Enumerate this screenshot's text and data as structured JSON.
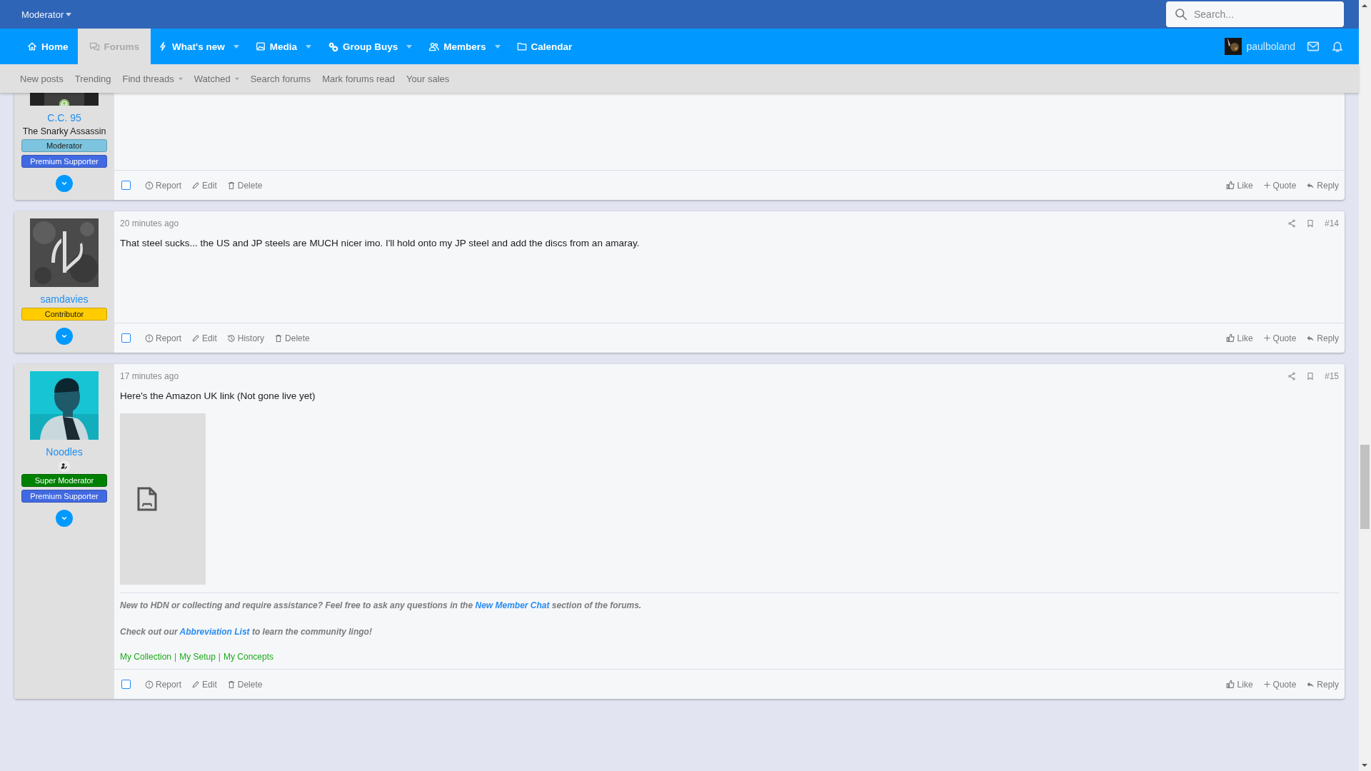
{
  "top_bar": {
    "menu_label": "Moderator",
    "search": {
      "placeholder": "Search..."
    }
  },
  "nav": {
    "tabs": [
      {
        "kind": "home",
        "label": "Home",
        "has_menu": false,
        "selected": false
      },
      {
        "kind": "forums",
        "label": "Forums",
        "has_menu": false,
        "selected": true
      },
      {
        "kind": "whats-new",
        "label": "What's new",
        "has_menu": true,
        "selected": false
      },
      {
        "kind": "media",
        "label": "Media",
        "has_menu": true,
        "selected": false
      },
      {
        "kind": "group-buys",
        "label": "Group Buys",
        "has_menu": true,
        "selected": false
      },
      {
        "kind": "members",
        "label": "Members",
        "has_menu": true,
        "selected": false
      },
      {
        "kind": "calendar",
        "label": "Calendar",
        "has_menu": false,
        "selected": false
      }
    ],
    "username": "paulboland"
  },
  "sub_nav": [
    {
      "label": "New posts",
      "has_menu": false
    },
    {
      "label": "Trending",
      "has_menu": false
    },
    {
      "label": "Find threads",
      "has_menu": true
    },
    {
      "label": "Watched",
      "has_menu": true
    },
    {
      "label": "Search forums",
      "has_menu": false
    },
    {
      "label": "Mark forums read",
      "has_menu": false
    },
    {
      "label": "Your sales",
      "has_menu": false
    }
  ],
  "posts": [
    {
      "user": {
        "name": "C.C. 95",
        "title": "The Snarky Assassin",
        "online": true,
        "role_icon": false,
        "badges": [
          {
            "label": "Moderator",
            "color": "#7cc4df"
          },
          {
            "label": "Premium Supporter",
            "color": "#4169e1"
          }
        ]
      },
      "checked": false,
      "actions_left": [
        {
          "kind": "report",
          "label": "Report"
        },
        {
          "kind": "edit",
          "label": "Edit"
        },
        {
          "kind": "delete",
          "label": "Delete"
        }
      ],
      "actions_right": [
        {
          "kind": "like",
          "label": "Like"
        },
        {
          "kind": "quote",
          "label": "Quote"
        },
        {
          "kind": "reply",
          "label": "Reply"
        }
      ]
    },
    {
      "user": {
        "name": "samdavies",
        "online": false,
        "role_icon": false,
        "badges": [
          {
            "label": "Contributor",
            "color": "#ffcc00"
          }
        ]
      },
      "date": "20 minutes ago",
      "number": "#14",
      "text": "That steel sucks... the US and JP steels are MUCH nicer imo. I'll hold onto my JP steel and add the discs from an amaray.",
      "checked": false,
      "actions_left": [
        {
          "kind": "report",
          "label": "Report"
        },
        {
          "kind": "edit",
          "label": "Edit"
        },
        {
          "kind": "history",
          "label": "History"
        },
        {
          "kind": "delete",
          "label": "Delete"
        }
      ],
      "actions_right": [
        {
          "kind": "like",
          "label": "Like"
        },
        {
          "kind": "quote",
          "label": "Quote"
        },
        {
          "kind": "reply",
          "label": "Reply"
        }
      ]
    },
    {
      "user": {
        "name": "Noodles",
        "online": false,
        "role_icon": true,
        "badges": [
          {
            "label": "Super Moderator",
            "color": "#008000"
          },
          {
            "label": "Premium Supporter",
            "color": "#4169e1"
          }
        ]
      },
      "date": "17 minutes ago",
      "number": "#15",
      "text": "Here's the Amazon UK link (Not gone live yet)",
      "attachment": {
        "kind": "broken-image"
      },
      "signature": {
        "lines": [
          {
            "before": "New to HDN or collecting and require assistance? Feel free to ask any questions in the ",
            "link": "New Member Chat",
            "after": " section of the forums."
          },
          {
            "before": "Check out our ",
            "link": "Abbreviation List",
            "after": " to learn the community lingo!"
          }
        ],
        "links": [
          "My Collection",
          "My Setup",
          "My Concepts"
        ],
        "separator": "|"
      },
      "checked": false,
      "actions_left": [
        {
          "kind": "report",
          "label": "Report"
        },
        {
          "kind": "edit",
          "label": "Edit"
        },
        {
          "kind": "delete",
          "label": "Delete"
        }
      ],
      "actions_right": [
        {
          "kind": "like",
          "label": "Like"
        },
        {
          "kind": "quote",
          "label": "Quote"
        },
        {
          "kind": "reply",
          "label": "Reply"
        }
      ]
    }
  ]
}
